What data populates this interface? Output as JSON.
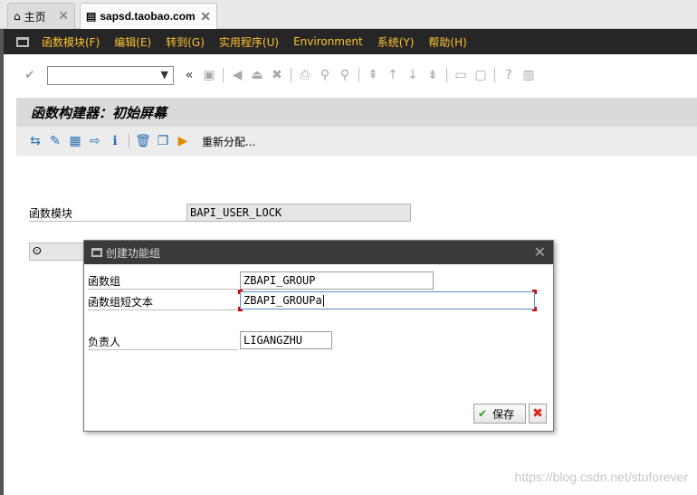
{
  "browser": {
    "tabs": [
      {
        "label": "主页",
        "icon": "home-icon"
      },
      {
        "label": "sapsd.taobao.com",
        "icon": "page-icon"
      }
    ],
    "close_glyph": "✕"
  },
  "menubar": {
    "items": [
      "函数模块(F)",
      "编辑(E)",
      "转到(G)",
      "实用程序(U)",
      "Environment",
      "系统(Y)",
      "帮助(H)"
    ]
  },
  "toolbar": {
    "command_value": "",
    "nav_back_glyph": "«"
  },
  "screen": {
    "title": "函数构建器：初始屏幕",
    "reassign_label": "重新分配..."
  },
  "main_form": {
    "function_module_label": "函数模块",
    "function_module_value": "BAPI_USER_LOCK"
  },
  "dialog": {
    "title": "创建功能组",
    "fields": {
      "group_label": "函数组",
      "group_value": "ZBAPI_GROUP",
      "short_text_label": "函数组短文本",
      "short_text_value": "ZBAPI_GROUPa",
      "owner_label": "负责人",
      "owner_value": "LIGANGZHU"
    },
    "save_label": "保存"
  },
  "watermark": "https://blog.csdn.net/stuforever"
}
